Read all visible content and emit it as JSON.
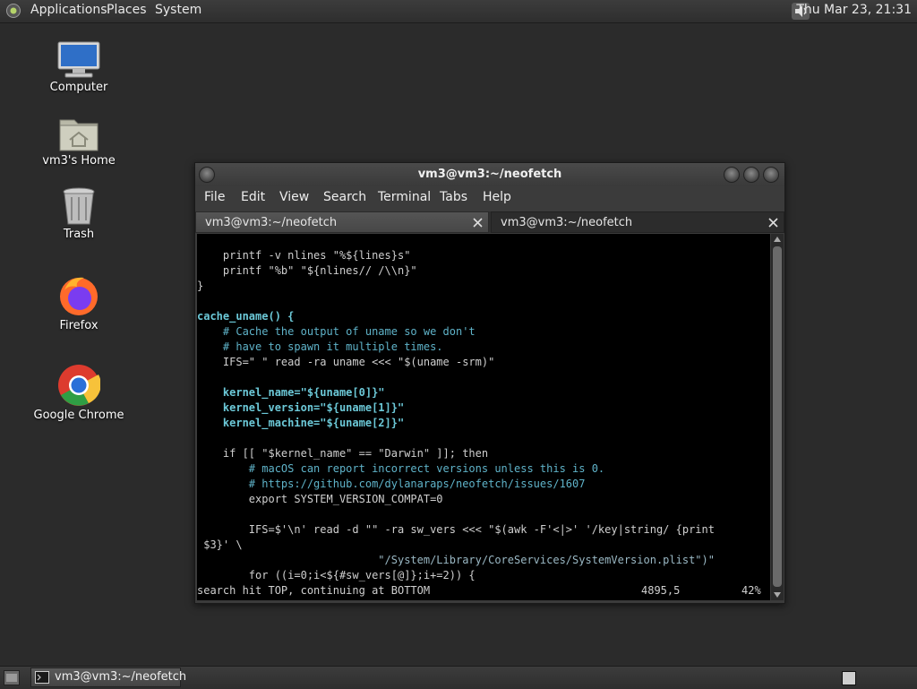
{
  "top_panel": {
    "menus": [
      "Applications",
      "Places",
      "System"
    ],
    "clock": "Thu Mar 23, 21:31",
    "icons": [
      "apps-icon",
      "volume-icon"
    ]
  },
  "desktop": {
    "icons": [
      {
        "label": "Computer",
        "icon": "computer-icon"
      },
      {
        "label": "vm3's Home",
        "icon": "home-folder-icon"
      },
      {
        "label": "Trash",
        "icon": "trash-icon"
      },
      {
        "label": "Firefox",
        "icon": "firefox-icon"
      },
      {
        "label": "Google Chrome",
        "icon": "chrome-icon"
      }
    ]
  },
  "terminal": {
    "title": "vm3@vm3:~/neofetch",
    "menu": [
      "File",
      "Edit",
      "View",
      "Search",
      "Terminal",
      "Tabs",
      "Help"
    ],
    "tabs": [
      "vm3@vm3:~/neofetch",
      "vm3@vm3:~/neofetch"
    ],
    "lines": [
      "    printf -v nlines \"%${lines}s\"",
      "    printf \"%b\" \"${nlines// /\\\\n}\"",
      "}",
      "",
      "cache_uname() {",
      "    # Cache the output of uname so we don't",
      "    # have to spawn it multiple times.",
      "    IFS=\" \" read -ra uname <<< \"$(uname -srm)\"",
      "",
      "    kernel_name=\"${uname[0]}\"",
      "    kernel_version=\"${uname[1]}\"",
      "    kernel_machine=\"${uname[2]}\"",
      "",
      "    if [[ \"$kernel_name\" == \"Darwin\" ]]; then",
      "        # macOS can report incorrect versions unless this is 0.",
      "        # https://github.com/dylanaraps/neofetch/issues/1607",
      "        export SYSTEM_VERSION_COMPAT=0",
      "",
      "        IFS=$'\\n' read -d \"\" -ra sw_vers <<< \"$(awk -F'<|>' '/key|string/ {print",
      " $3}' \\",
      "                            \"/System/Library/CoreServices/SystemVersion.plist\")\"",
      "        for ((i=0;i<${#sw_vers[@]};i+=2)) {"
    ],
    "status": {
      "message": "search hit TOP, continuing at BOTTOM",
      "position": "4895,5",
      "percent": "42%"
    }
  },
  "bottom_panel": {
    "task": "vm3@vm3:~/neofetch"
  },
  "colors": {
    "terminal_bg": "#000000",
    "comment": "#5fb3c9",
    "variable": "#6cc9d8",
    "string": "#9ab8c4"
  }
}
